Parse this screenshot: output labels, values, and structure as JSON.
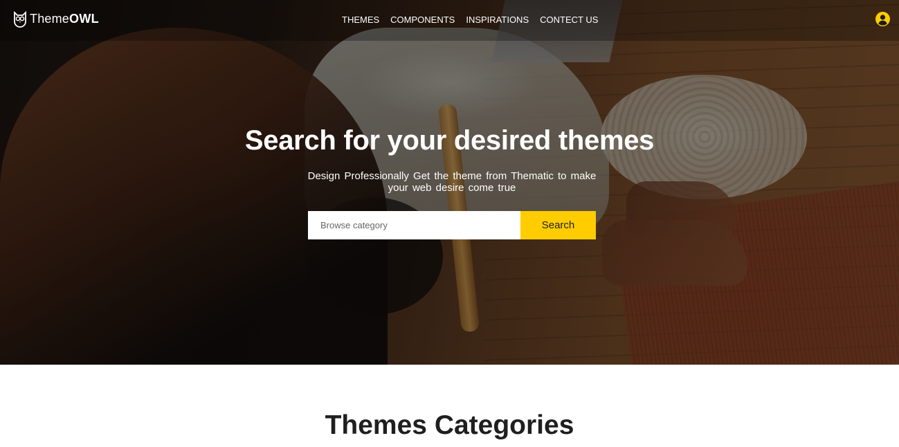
{
  "brand": {
    "name_light": "Theme",
    "name_bold": "OWL"
  },
  "nav": {
    "items": [
      {
        "label": "THEMES"
      },
      {
        "label": "COMPONENTS"
      },
      {
        "label": "INSPIRATIONS"
      },
      {
        "label": "CONTECT US"
      }
    ],
    "user_icon": "user-circle-icon",
    "logo_icon": "owl-icon"
  },
  "hero": {
    "title": "Search for your desired themes",
    "subtitle": "Design Professionally Get the theme from Thematic to make your web desire come true",
    "search": {
      "placeholder": "Browse category",
      "value": "",
      "button_label": "Search"
    }
  },
  "section": {
    "title": "Themes Categories"
  },
  "colors": {
    "accent": "#ffcc00",
    "heading": "#1f1f1f",
    "nav_text": "#ffffff"
  }
}
